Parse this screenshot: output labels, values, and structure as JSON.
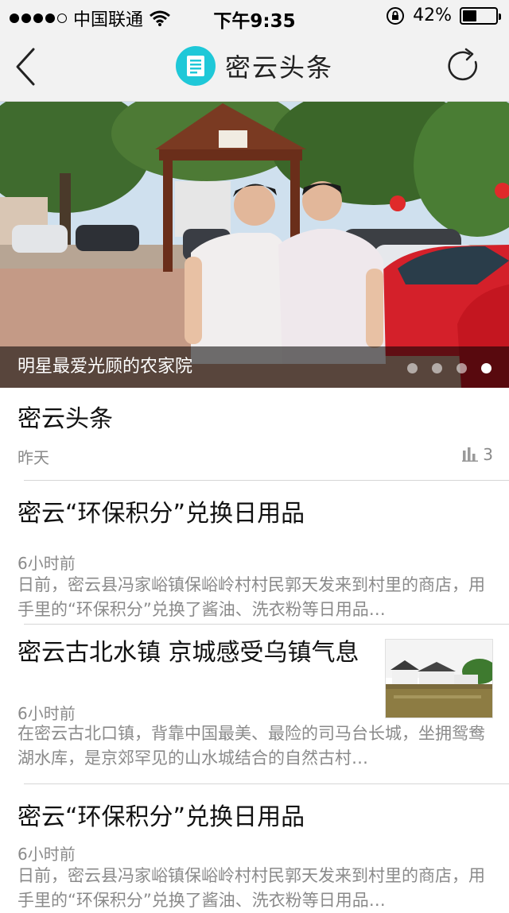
{
  "status_bar": {
    "carrier": "中国联通",
    "time": "下午9:35",
    "battery": "42%",
    "battery_level": 0.42
  },
  "nav": {
    "title": "密云头条"
  },
  "banner": {
    "caption": "明星最爱光顾的农家院",
    "pages": 4,
    "active_page": 4
  },
  "feed": [
    {
      "title": "密云头条",
      "time": "昨天",
      "views": "3"
    },
    {
      "title": "密云“环保积分”兑换日用品",
      "time": "6小时前",
      "summary": "日前，密云县冯家峪镇保峪岭村村民郭天发来到村里的商店，用手里的“环保积分”兑换了酱油、洗衣粉等日用品…"
    },
    {
      "title": "密云古北水镇 京城感受乌镇气息",
      "time": "6小时前",
      "summary": "在密云古北口镇，背靠中国最美、最险的司马台长城，坐拥鸳鸯湖水库，是京郊罕见的山水城结合的自然古村…"
    },
    {
      "title": "密云“环保积分”兑换日用品",
      "time": "6小时前",
      "summary": "日前，密云县冯家峪镇保峪岭村村民郭天发来到村里的商店，用手里的“环保积分”兑换了酱油、洗衣粉等日用品…"
    }
  ],
  "icons": {
    "back": "chevron-left-icon",
    "refresh": "refresh-icon",
    "logo": "news-logo-icon",
    "views": "bar-chart-icon"
  },
  "colors": {
    "accent": "#1fc8d8"
  }
}
